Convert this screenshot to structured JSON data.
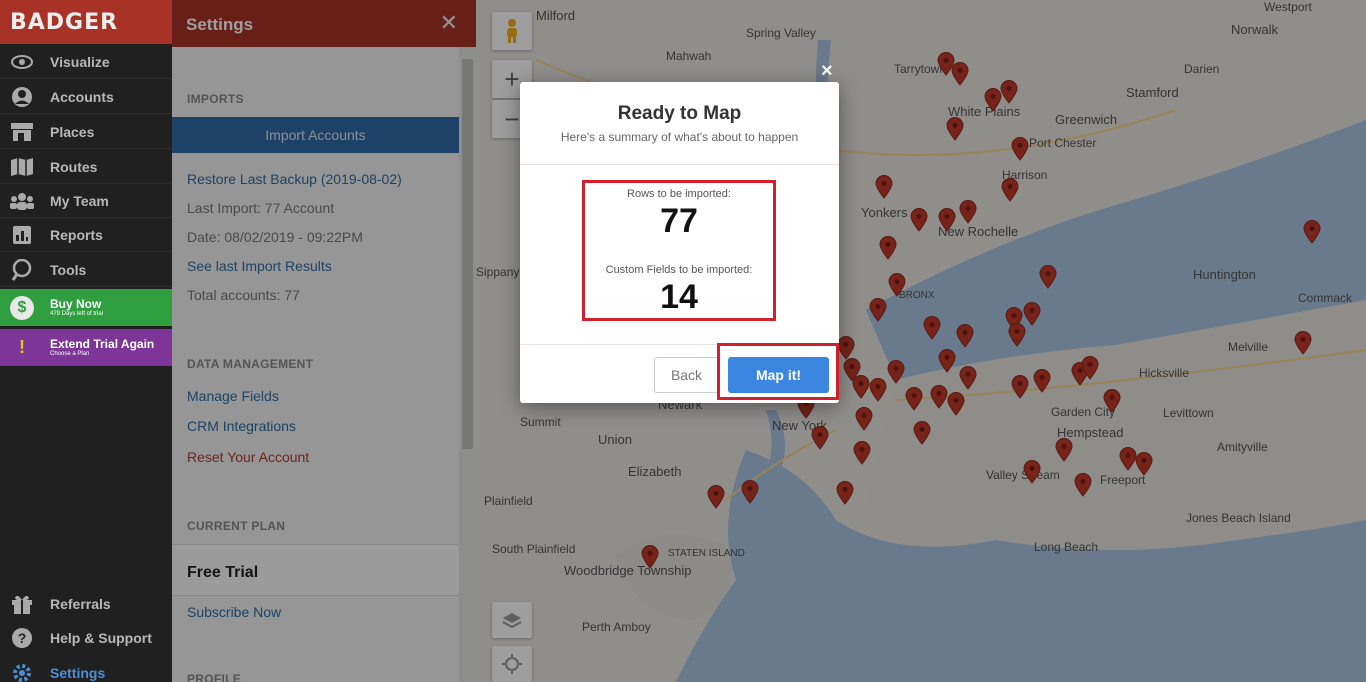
{
  "nav": {
    "logo": "BADGER",
    "items": [
      {
        "label": "Visualize",
        "icon": "eye-icon"
      },
      {
        "label": "Accounts",
        "icon": "user-circle-icon"
      },
      {
        "label": "Places",
        "icon": "store-icon"
      },
      {
        "label": "Routes",
        "icon": "map-icon"
      },
      {
        "label": "My Team",
        "icon": "team-icon"
      },
      {
        "label": "Reports",
        "icon": "report-icon"
      },
      {
        "label": "Tools",
        "icon": "tools-icon"
      }
    ],
    "buy_now": {
      "title": "Buy Now",
      "subtitle": "479 Days left of trial",
      "color": "#2e9e3e"
    },
    "extend_trial": {
      "title": "Extend Trial Again",
      "subtitle": "Choose a Plan",
      "color": "#7d3597"
    },
    "bottom_items": [
      {
        "label": "Referrals",
        "icon": "gift-icon"
      },
      {
        "label": "Help & Support",
        "icon": "help-icon"
      },
      {
        "label": "Settings",
        "icon": "gear-icon"
      }
    ]
  },
  "settings": {
    "title": "Settings",
    "imports_heading": "IMPORTS",
    "import_button": "Import Accounts",
    "restore_link": "Restore Last Backup (2019-08-02)",
    "last_import": "Last Import: 77 Account",
    "date": "Date: 08/02/2019 - 09:22PM",
    "see_results_link": "See last Import Results",
    "total_accounts": "Total accounts: 77",
    "data_mgmt_heading": "DATA MANAGEMENT",
    "manage_fields": "Manage Fields",
    "crm_integrations": "CRM Integrations",
    "reset_account": "Reset Your Account",
    "current_plan_heading": "CURRENT PLAN",
    "plan_name": "Free Trial",
    "subscribe_link": "Subscribe Now",
    "profile_heading": "PROFILE"
  },
  "map": {
    "labels": [
      "Milford",
      "Spring Valley",
      "Mahwah",
      "Tarrytown",
      "White Plains",
      "Port Chester",
      "Harrison",
      "Greenwich",
      "Stamford",
      "Norwalk",
      "Westport",
      "Darien",
      "Yonkers",
      "New Rochelle",
      "Huntington",
      "Commack",
      "Melville",
      "Hicksville",
      "Levittown",
      "Garden City",
      "Hempstead",
      "Amityville",
      "Freeport",
      "Valley Stream",
      "Long Beach",
      "Jones Beach Island",
      "Union",
      "Elizabeth",
      "Newark",
      "New York",
      "Plainfield",
      "South Plainfield",
      "Woodbridge Township",
      "Perth Amboy",
      "Summit",
      "STATEN ISLAND",
      "BRONX",
      "Sippany Hills"
    ]
  },
  "modal": {
    "title": "Ready to Map",
    "subtitle": "Here's a summary of what's about to happen",
    "rows_label": "Rows to be imported:",
    "rows_value": "77",
    "fields_label": "Custom Fields to be imported:",
    "fields_value": "14",
    "back_button": "Back",
    "map_button": "Map it!",
    "close": "×"
  },
  "colors": {
    "brand_red": "#a93226",
    "import_blue": "#2f6aa6",
    "map_button_blue": "#3b86e0",
    "highlight_red": "#d0202e"
  }
}
